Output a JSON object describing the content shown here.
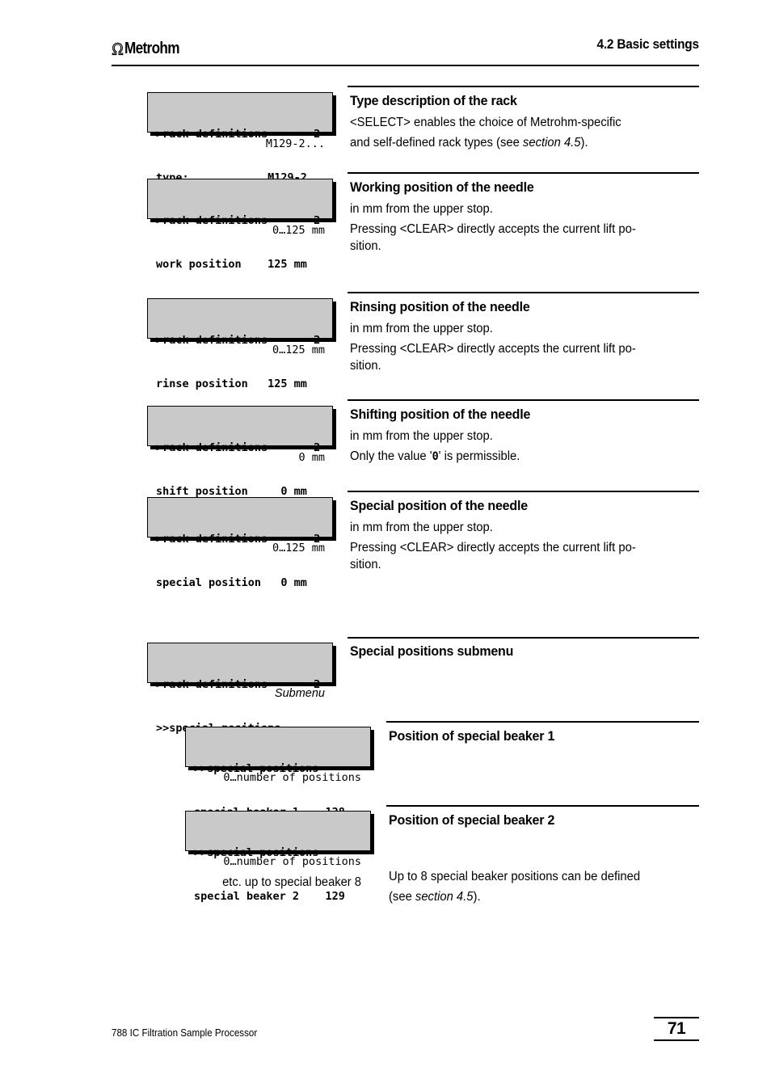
{
  "header": {
    "logo_text": "Metrohm",
    "logo_icon": "metrohm-omega-logo",
    "title": "4.2  Basic settings"
  },
  "footer": {
    "document_title": "788 IC Filtration Sample Processor",
    "page_number": "71"
  },
  "sections": [
    {
      "id": "rack-type",
      "lcd_line1": ">rack definitions       2",
      "lcd_line2": "type:            M129-2",
      "caption": "M129-2...",
      "heading": "Type description of the rack",
      "body_1": "<SELECT> enables the choice of Metrohm-specific",
      "body_2_pre": "and self-defined rack types (see ",
      "body_2_italic": "section 4.5",
      "body_2_post": ")."
    },
    {
      "id": "work-position",
      "lcd_line1": ">rack definitions       2",
      "lcd_line2": "work position    125 mm",
      "caption": "0…125 mm",
      "heading": "Working position of the needle",
      "body_1": "in mm from the upper stop.",
      "body_2": "Pressing <CLEAR> directly accepts the current lift po-",
      "body_3": "sition."
    },
    {
      "id": "rinse-position",
      "lcd_line1": ">rack definitions       2",
      "lcd_line2": "rinse position   125 mm",
      "caption": "0…125 mm",
      "heading": "Rinsing position of the needle",
      "body_1": "in mm from the upper stop.",
      "body_2": "Pressing <CLEAR> directly accepts the current lift po-",
      "body_3": "sition."
    },
    {
      "id": "shift-position",
      "lcd_line1": ">rack definitions       2",
      "lcd_line2": "shift position     0 mm",
      "caption": "0 mm",
      "heading": "Shifting position of the needle",
      "body_1": "in mm from the upper stop.",
      "body_2_pre": "Only the value '",
      "body_2_mono": "0",
      "body_2_post": "' is permissible."
    },
    {
      "id": "special-position",
      "lcd_line1": ">rack definitions       2",
      "lcd_line2": "special position   0 mm",
      "caption": "0…125 mm",
      "heading": "Special position of the needle",
      "body_1": "in mm from the upper stop.",
      "body_2": "Pressing <CLEAR> directly accepts the current lift po-",
      "body_3": "sition."
    },
    {
      "id": "special-positions-submenu",
      "lcd_line1": ">rack definitions       2",
      "lcd_line2": ">>special positions",
      "caption": "Submenu",
      "heading": "Special positions submenu"
    },
    {
      "id": "special-beaker-1",
      "lcd_line1": ">>special positions",
      "lcd_line2": "special beaker 1    128",
      "caption": "0…number of positions",
      "heading": "Position of special beaker 1"
    },
    {
      "id": "special-beaker-2",
      "lcd_line1": ">>special positions",
      "lcd_line2": "special beaker 2    129",
      "caption": "0…number of positions",
      "caption2": "etc. up to special beaker 8",
      "heading": "Position of special beaker 2",
      "body_1_pre": "Up to 8 special beaker positions can be defined",
      "body_1_italic": "section 4.5",
      "body_1_mid": "(see ",
      "body_1_post": ")."
    }
  ]
}
